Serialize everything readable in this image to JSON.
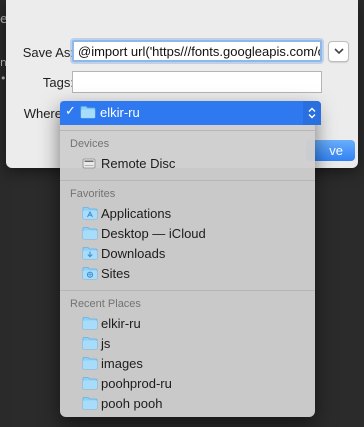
{
  "background": {
    "glyphs": [
      "ep",
      "no",
      "•"
    ]
  },
  "dialog": {
    "save_as_label": "Save As:",
    "save_as_value": "@import url('https///fonts.googleapis.com/css?family=Roboto",
    "tags_label": "Tags:",
    "tags_value": "",
    "where_label": "Where",
    "save_button": "ve",
    "colors": {
      "accent": "#2e79f0",
      "sheet": "#ececec",
      "menu": "#cecece"
    }
  },
  "menu": {
    "selected": {
      "check": "✓",
      "label": "elkir-ru",
      "icon": "folder-icon"
    },
    "sections": [
      {
        "header": "Devices",
        "items": [
          {
            "label": "Remote Disc",
            "icon": "disc-drive-icon"
          }
        ]
      },
      {
        "header": "Favorites",
        "items": [
          {
            "label": "Applications",
            "icon": "applications-folder-icon"
          },
          {
            "label": "Desktop — iCloud",
            "icon": "desktop-folder-icon"
          },
          {
            "label": "Downloads",
            "icon": "downloads-folder-icon"
          },
          {
            "label": "Sites",
            "icon": "sites-folder-icon"
          }
        ]
      },
      {
        "header": "Recent Places",
        "items": [
          {
            "label": "elkir-ru",
            "icon": "folder-icon"
          },
          {
            "label": "js",
            "icon": "folder-icon"
          },
          {
            "label": "images",
            "icon": "folder-icon"
          },
          {
            "label": "poohprod-ru",
            "icon": "folder-icon"
          },
          {
            "label": "pooh pooh",
            "icon": "folder-icon"
          }
        ]
      }
    ]
  }
}
